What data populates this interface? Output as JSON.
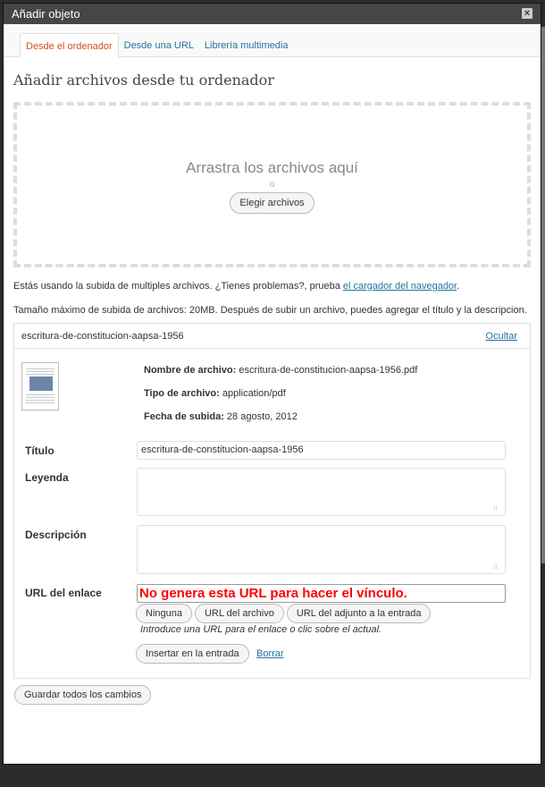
{
  "dialog": {
    "title": "Añadir objeto",
    "close_glyph": "×"
  },
  "tabs": [
    {
      "label": "Desde el ordenador",
      "active": true
    },
    {
      "label": "Desde una URL",
      "active": false
    },
    {
      "label": "Librería multimedia",
      "active": false
    }
  ],
  "section_title": "Añadir archivos desde tu ordenador",
  "dropzone": {
    "title": "Arrastra los archivos aquí",
    "or": "o",
    "button": "Elegir archivos"
  },
  "notes": {
    "multi_upload_prefix": "Estás usando la subida de multiples archivos. ¿Tienes problemas?, prueba ",
    "browser_uploader_link": "el cargador del navegador",
    "multi_upload_suffix": ".",
    "max_size": "Tamaño máximo de subida de archivos: 20MB. Después de subir un archivo, puedes agregar el título y la descripcion."
  },
  "item": {
    "filename_header": "escritura-de-constitucion-aapsa-1956",
    "hide_link": "Ocultar",
    "file_name_label": "Nombre de archivo:",
    "file_name": "escritura-de-constitucion-aapsa-1956.pdf",
    "file_type_label": "Tipo de archivo:",
    "file_type": "application/pdf",
    "upload_date_label": "Fecha de subida:",
    "upload_date": "28 agosto, 2012",
    "title_label": "Título",
    "title_value": "escritura-de-constitucion-aapsa-1956",
    "caption_label": "Leyenda",
    "caption_value": "",
    "description_label": "Descripción",
    "description_value": "",
    "link_url_label": "URL del enlace",
    "link_url_value": "No genera esta URL para hacer el vínculo.",
    "url_buttons": [
      "Ninguna",
      "URL del archivo",
      "URL del adjunto a la entrada"
    ],
    "url_help": "Introduce una URL para el enlace o clic sobre el actual.",
    "insert_button": "Insertar en la entrada",
    "delete_link": "Borrar",
    "thumbnail_icon": "pdf-thumbnail-icon"
  },
  "save_all_button": "Guardar todos los cambios",
  "colors": {
    "active_tab": "#d54e21",
    "link": "#21759b",
    "annotation": "#ff0000",
    "titlebar": "#464646"
  }
}
